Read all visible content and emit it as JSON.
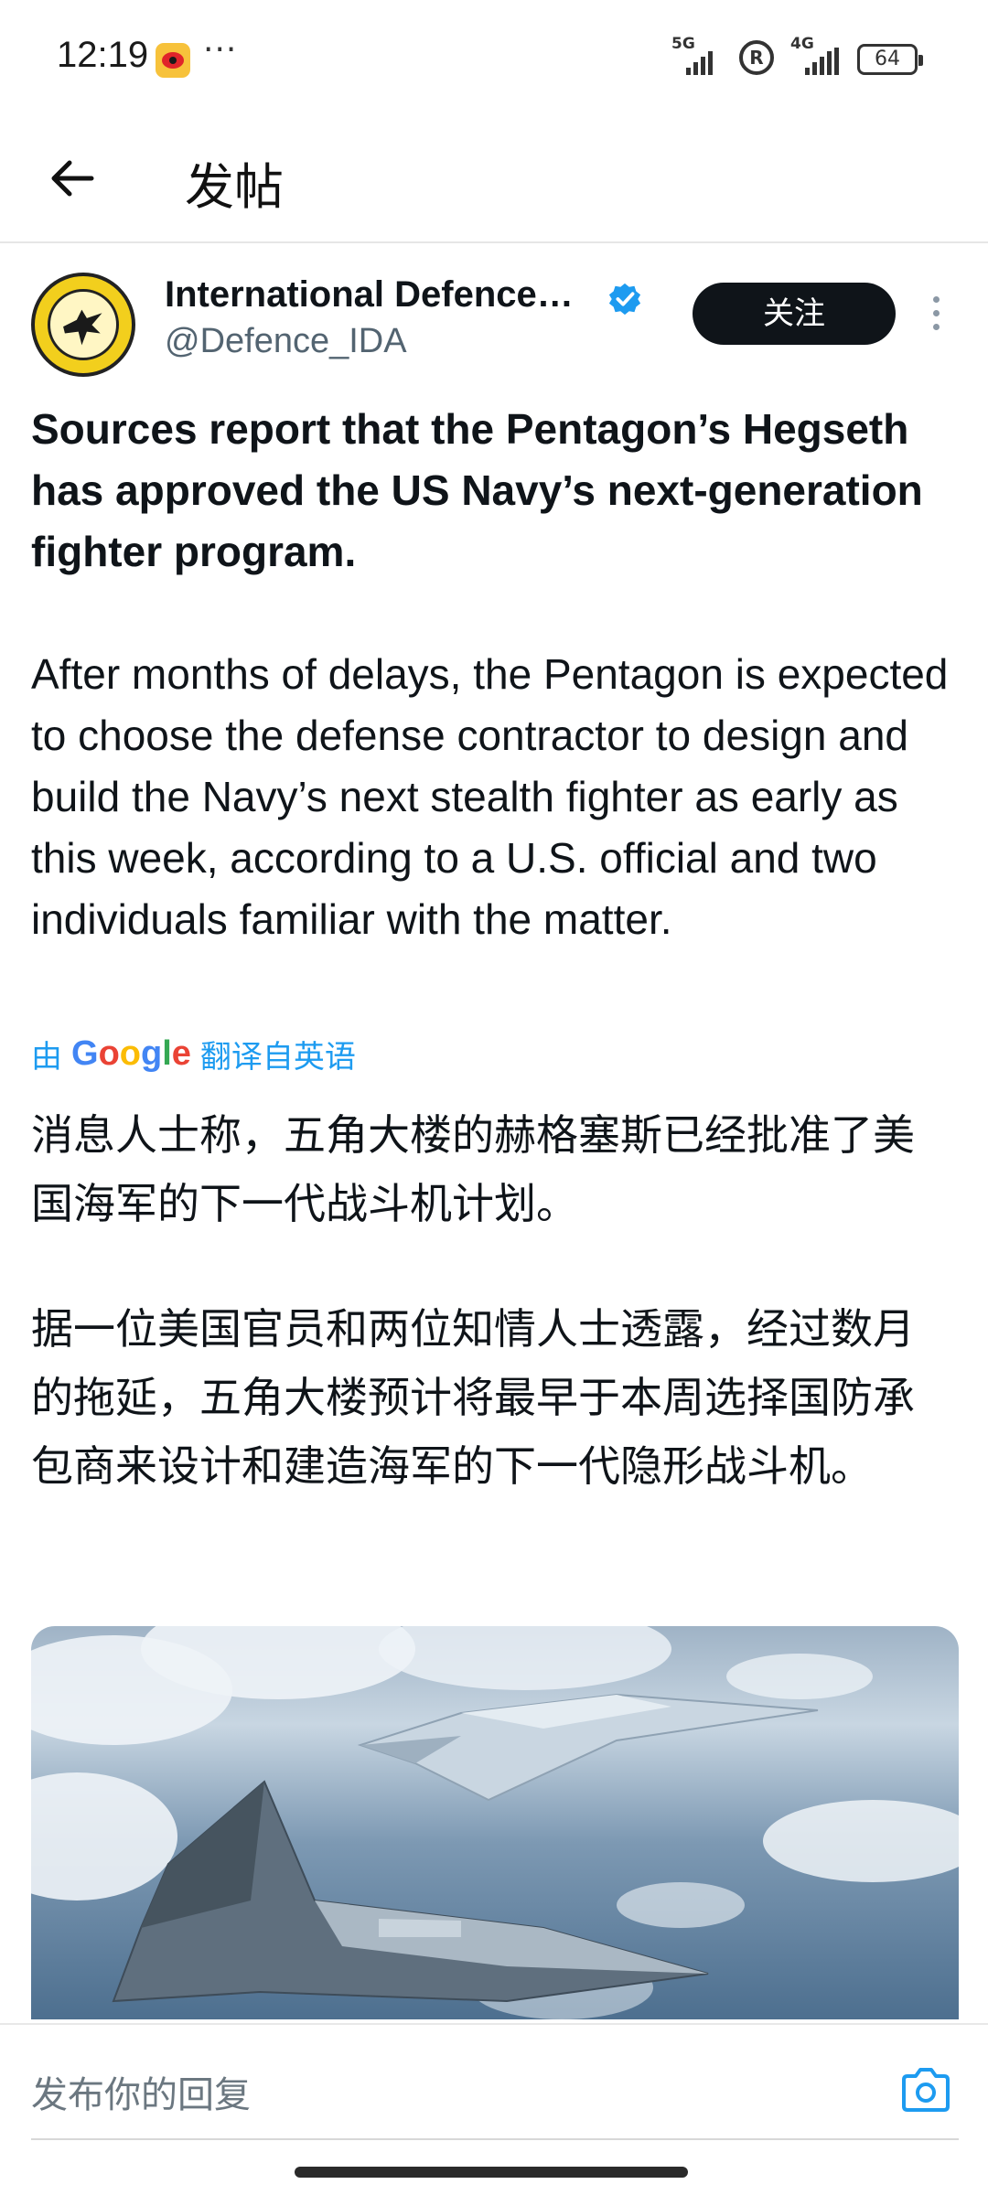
{
  "status_bar": {
    "time": "12:19",
    "more": "···",
    "signal1_label": "5G",
    "signal2_label": "4G",
    "battery": "64"
  },
  "header": {
    "title": "发帖",
    "back_icon": "arrow-left-icon"
  },
  "post": {
    "author_name": "International Defence…",
    "handle": "@Defence_IDA",
    "verified_color": "#1d9bf0",
    "follow_label": "关注",
    "headline": "Sources report that the Pentagon’s Hegseth has approved the US Navy’s next-generation fighter program.",
    "body": "After months of delays, the Pentagon is expected to choose the defense contractor to design and build the Navy’s next stealth fighter as early as this week, according to a U.S. official and two individuals familiar with the matter.",
    "translate_prefix": "由",
    "translate_brand": "Google",
    "translate_suffix": "翻译自英语",
    "translation_p1": "消息人士称，五角大楼的赫格塞斯已经批准了美国海军的下一代战斗机计划。",
    "translation_p2": "据一位美国官员和两位知情人士透露，经过数月的拖延，五角大楼预计将最早于本周选择国防承包商来设计和建造海军的下一代隐形战斗机。"
  },
  "reply": {
    "placeholder": "发布你的回复",
    "camera_icon": "camera-icon"
  },
  "colors": {
    "accent": "#1d9bf0",
    "text": "#0f1419",
    "muted": "#536471"
  }
}
